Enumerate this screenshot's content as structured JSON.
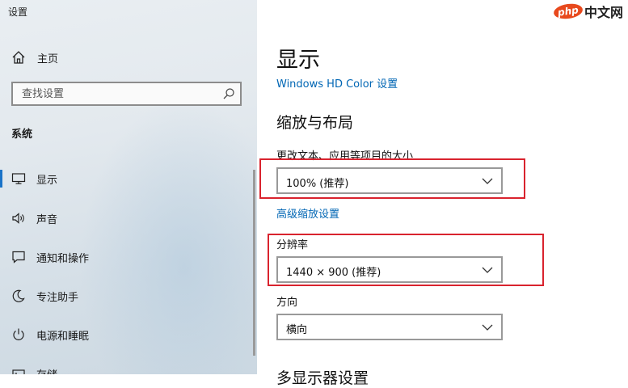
{
  "window": {
    "title": "设置"
  },
  "sidebar": {
    "home_label": "主页",
    "search_placeholder": "查找设置",
    "section_title": "系统",
    "items": [
      {
        "label": "显示",
        "icon": "monitor-icon",
        "active": true
      },
      {
        "label": "声音",
        "icon": "speaker-icon",
        "active": false
      },
      {
        "label": "通知和操作",
        "icon": "notification-icon",
        "active": false
      },
      {
        "label": "专注助手",
        "icon": "focus-assist-icon",
        "active": false
      },
      {
        "label": "电源和睡眠",
        "icon": "power-icon",
        "active": false
      },
      {
        "label": "存储",
        "icon": "storage-icon",
        "active": false
      }
    ]
  },
  "main": {
    "title": "显示",
    "hd_color_link": "Windows HD Color 设置",
    "scale_section_title": "缩放与布局",
    "scale_label": "更改文本、应用等项目的大小",
    "scale_value": "100% (推荐)",
    "advanced_scaling_link": "高级缩放设置",
    "resolution_label": "分辨率",
    "resolution_value": "1440 × 900 (推荐)",
    "orientation_label": "方向",
    "orientation_value": "横向",
    "next_section_title": "多显示器设置"
  },
  "watermark": {
    "logo": "php",
    "text": "中文网"
  },
  "colors": {
    "accent": "#0066b4",
    "highlight_box": "#d9232e",
    "active_bar": "#1a73c8"
  }
}
